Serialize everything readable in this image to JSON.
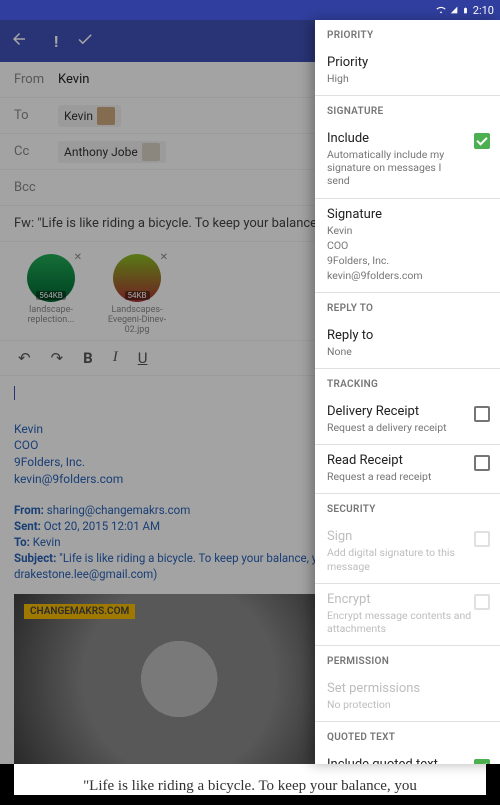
{
  "status": {
    "time": "2:10"
  },
  "compose": {
    "from_label": "From",
    "from_value": "Kevin",
    "to_label": "To",
    "to_chip": "Kevin",
    "cc_label": "Cc",
    "cc_chip": "Anthony Jobe",
    "bcc_label": "Bcc",
    "subject": "Fw: \"Life is like riding a bicycle. To keep your balance, you",
    "attachments": [
      {
        "name": "landscape-replection...",
        "size": "564KB"
      },
      {
        "name": "Landscapes-Evegeni-Dinev-02.jpg",
        "size": "54KB"
      }
    ],
    "signature": {
      "line1": "Kevin",
      "line2": "COO",
      "line3": "9Folders, Inc.",
      "line4": "kevin@9folders.com"
    },
    "forwarded": {
      "from_k": "From:",
      "from_v": " sharing@changemakrs.com",
      "sent_k": "Sent:",
      "sent_v": " Oct 20, 2015 12:01 AM",
      "to_k": "To:",
      "to_v": " Kevin",
      "subj_k": "Subject:",
      "subj_v": " \"Life is like riding a bicycle. To keep your balance, you must ke",
      "extra": "drakestone.lee@gmail.com)"
    },
    "image_badge": "CHANGEMAKRS.COM",
    "quote": "\"Life is like riding a bicycle. To keep your balance, you"
  },
  "drawer": {
    "priority_h": "PRIORITY",
    "priority_t": "Priority",
    "priority_s": "High",
    "signature_h": "SIGNATURE",
    "include_t": "Include",
    "include_s": "Automatically include my signature on messages I send",
    "sig_t": "Signature",
    "sig_l1": "Kevin",
    "sig_l2": "COO",
    "sig_l3": "9Folders, Inc.",
    "sig_l4": "kevin@9folders.com",
    "replyto_h": "REPLY TO",
    "replyto_t": "Reply to",
    "replyto_s": "None",
    "tracking_h": "TRACKING",
    "deliv_t": "Delivery Receipt",
    "deliv_s": "Request a delivery receipt",
    "read_t": "Read Receipt",
    "read_s": "Request a read receipt",
    "security_h": "SECURITY",
    "sign_t": "Sign",
    "sign_s": "Add digital signature to this message",
    "enc_t": "Encrypt",
    "enc_s": "Encrypt message contents and attachments",
    "perm_h": "PERMISSION",
    "perm_t": "Set permissions",
    "perm_s": "No protection",
    "quoted_h": "QUOTED TEXT",
    "quoted_t": "Include quoted text"
  }
}
